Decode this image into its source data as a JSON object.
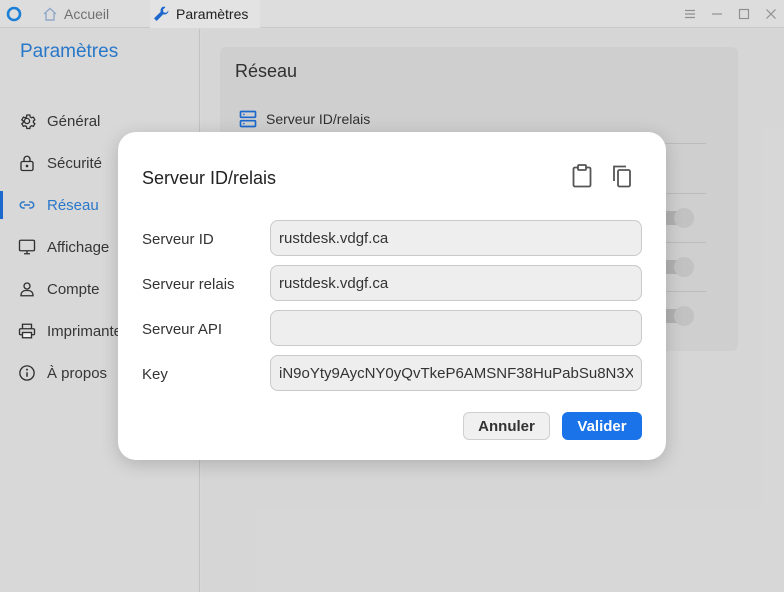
{
  "tabs": [
    {
      "label": "Accueil",
      "icon": "home-icon"
    },
    {
      "label": "Paramètres",
      "icon": "wrench-icon",
      "active": true
    }
  ],
  "sidebar": {
    "title": "Paramètres",
    "items": [
      {
        "label": "Général",
        "icon": "gear-icon"
      },
      {
        "label": "Sécurité",
        "icon": "lock-icon"
      },
      {
        "label": "Réseau",
        "icon": "link-icon",
        "active": true
      },
      {
        "label": "Affichage",
        "icon": "monitor-icon"
      },
      {
        "label": "Compte",
        "icon": "user-icon"
      },
      {
        "label": "Imprimante",
        "icon": "printer-icon"
      },
      {
        "label": "À propos",
        "icon": "info-icon"
      }
    ]
  },
  "main": {
    "card_title": "Réseau",
    "row_label": "Serveur ID/relais"
  },
  "dialog": {
    "title": "Serveur ID/relais",
    "fields": [
      {
        "label": "Serveur ID",
        "value": "rustdesk.vdgf.ca"
      },
      {
        "label": "Serveur relais",
        "value": "rustdesk.vdgf.ca"
      },
      {
        "label": "Serveur API",
        "value": ""
      },
      {
        "label": "Key",
        "value": "iN9oYty9AycNY0yQvTkeP6AMSNF38HuPabSu8N3X"
      }
    ],
    "cancel_label": "Annuler",
    "ok_label": "Valider"
  },
  "colors": {
    "accent": "#2b7fd6",
    "primary_button": "#1a73e8"
  }
}
